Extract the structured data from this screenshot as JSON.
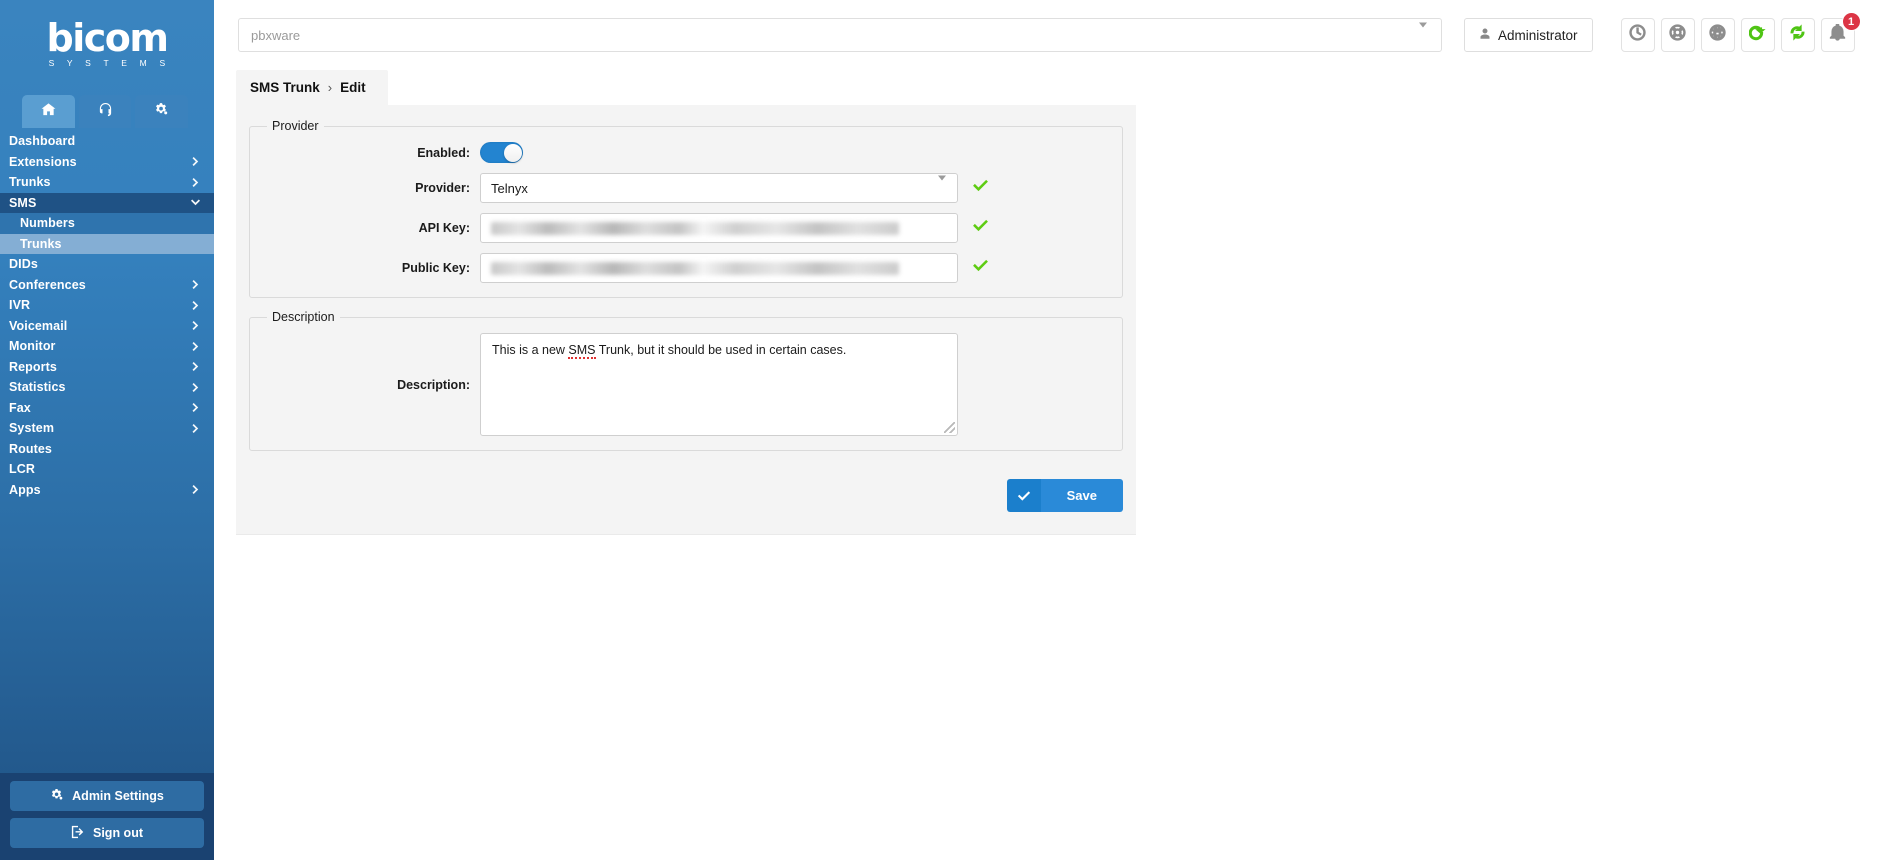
{
  "brand": {
    "logo_word": "bicom",
    "logo_sub": "S Y S T E M S"
  },
  "sidebar": {
    "tabs": [
      {
        "icon": "home-icon",
        "active": true
      },
      {
        "icon": "headset-icon",
        "active": false
      },
      {
        "icon": "gears-icon",
        "active": false
      }
    ],
    "items": [
      {
        "label": "Dashboard",
        "expandable": false,
        "state": "normal"
      },
      {
        "label": "Extensions",
        "expandable": true,
        "state": "normal"
      },
      {
        "label": "Trunks",
        "expandable": true,
        "state": "normal"
      },
      {
        "label": "SMS",
        "expandable": true,
        "state": "expanded"
      },
      {
        "label": "Numbers",
        "expandable": false,
        "state": "sub"
      },
      {
        "label": "Trunks",
        "expandable": false,
        "state": "sub-active"
      },
      {
        "label": "DIDs",
        "expandable": false,
        "state": "normal"
      },
      {
        "label": "Conferences",
        "expandable": true,
        "state": "normal"
      },
      {
        "label": "IVR",
        "expandable": true,
        "state": "normal"
      },
      {
        "label": "Voicemail",
        "expandable": true,
        "state": "normal"
      },
      {
        "label": "Monitor",
        "expandable": true,
        "state": "normal"
      },
      {
        "label": "Reports",
        "expandable": true,
        "state": "normal"
      },
      {
        "label": "Statistics",
        "expandable": true,
        "state": "normal"
      },
      {
        "label": "Fax",
        "expandable": true,
        "state": "normal"
      },
      {
        "label": "System",
        "expandable": true,
        "state": "normal"
      },
      {
        "label": "Routes",
        "expandable": false,
        "state": "normal"
      },
      {
        "label": "LCR",
        "expandable": false,
        "state": "normal"
      },
      {
        "label": "Apps",
        "expandable": true,
        "state": "normal"
      }
    ],
    "footer": {
      "admin_settings": "Admin Settings",
      "sign_out": "Sign out"
    }
  },
  "topbar": {
    "server_select_value": "pbxware",
    "admin_label": "Administrator",
    "icons": [
      {
        "name": "clock-icon",
        "color": "#8d8d8d"
      },
      {
        "name": "lifebuoy-icon",
        "color": "#8d8d8d"
      },
      {
        "name": "globe-icon",
        "color": "#8d8d8d"
      },
      {
        "name": "reload-icon",
        "color": "#4fc414"
      },
      {
        "name": "sync-icon",
        "color": "#4fc414"
      },
      {
        "name": "bell-icon",
        "color": "#8d8d8d"
      }
    ],
    "notification_count": "1"
  },
  "breadcrumb": {
    "root": "SMS Trunk",
    "separator": "›",
    "current": "Edit"
  },
  "form": {
    "provider_group": {
      "legend": "Provider",
      "enabled": {
        "label": "Enabled:",
        "value": "on"
      },
      "provider": {
        "label": "Provider:",
        "value": "Telnyx",
        "valid": true
      },
      "api_key": {
        "label": "API Key:",
        "value": "",
        "masked": true,
        "valid": true
      },
      "public_key": {
        "label": "Public Key:",
        "value": "",
        "masked": true,
        "valid": true
      }
    },
    "description_group": {
      "legend": "Description",
      "description": {
        "label": "Description:",
        "value_prefix": "This is a new ",
        "value_spellcheck": "SMS",
        "value_suffix": " Trunk, but it should be used in certain cases."
      }
    },
    "save_label": "Save"
  },
  "colors": {
    "sidebar_top": "#3a84bf",
    "sidebar_bottom": "#1f5183",
    "accent_blue": "#2a8ad8",
    "toggle_on": "#2384d0",
    "valid_green": "#5ecc12",
    "badge_red": "#dc3545"
  }
}
